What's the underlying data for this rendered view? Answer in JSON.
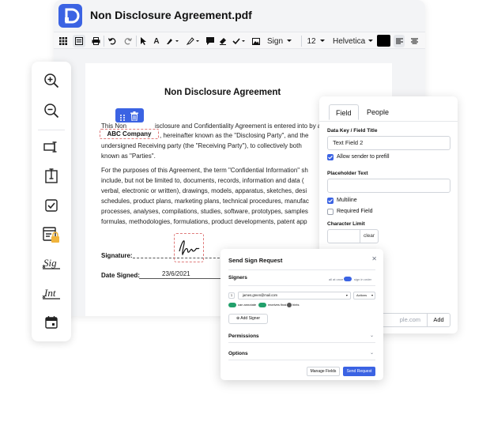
{
  "app": {
    "document_title": "Non Disclosure Agreement.pdf",
    "logo_icon": "document-logo-icon",
    "accent": "#3b63e3"
  },
  "toolbar": {
    "sign_label": "Sign",
    "font_size": "12",
    "font_family": "Helvetica",
    "text_color": "#000000"
  },
  "document": {
    "heading": "Non Disclosure Agreement",
    "p1_line1_pre": "This Non",
    "p1_line1_post": "isclosure and Confidentiality Agreement is entered into by and",
    "p1_line2_post": ", hereinafter known as the \"Disclosing Party\", and the",
    "p1_line3": "undersigned Receiving party (the \"Receiving Party\"), to collectively both",
    "p1_line4": "known as \"Parties\".",
    "p2_lines": [
      "For the purposes of this Agreement, the term \"Confidential Information\" sh",
      "include, but not be limited to, documents, records, information and data (",
      "verbal, electronic or written), drawings, models, apparatus, sketches, desi",
      "schedules, product plans, marketing plans, technical procedures, manufac",
      "processes, analyses, compilations, studies, software, prototypes, samples",
      "formulas, methodologies, formulations, product developments, patent app"
    ],
    "company_field": "ABC Company",
    "signature_label": "Signature:",
    "date_label": "Date Signed:",
    "date_value": "23/6/2021"
  },
  "field_panel": {
    "tabs": [
      "Field",
      "People"
    ],
    "active_tab": "Field",
    "key_label": "Data Key / Field Title",
    "key_value": "Text Field 2",
    "allow_prefill": "Allow sender to prefill",
    "placeholder_label": "Placeholder Text",
    "placeholder_value": "",
    "multiline": "Multiline",
    "required": "Required Field",
    "char_limit_label": "Character Limit",
    "clear": "clear",
    "email_placeholder": "ple.com",
    "add": "Add"
  },
  "modal": {
    "title": "Send Sign Request",
    "signers": "Signers",
    "all_at_once": "all at once",
    "sign_in_order": "sign in order",
    "signer_index": "1",
    "signer_email": "james.green@mail.com",
    "actions": "Actions",
    "can_annotate": "can annotate",
    "receives_final": "receives final",
    "hints": "hints",
    "add_signer": "Add Signer",
    "permissions": "Permissions",
    "options": "Options",
    "manage_fields": "Manage Fields",
    "send_request": "Send Request"
  }
}
